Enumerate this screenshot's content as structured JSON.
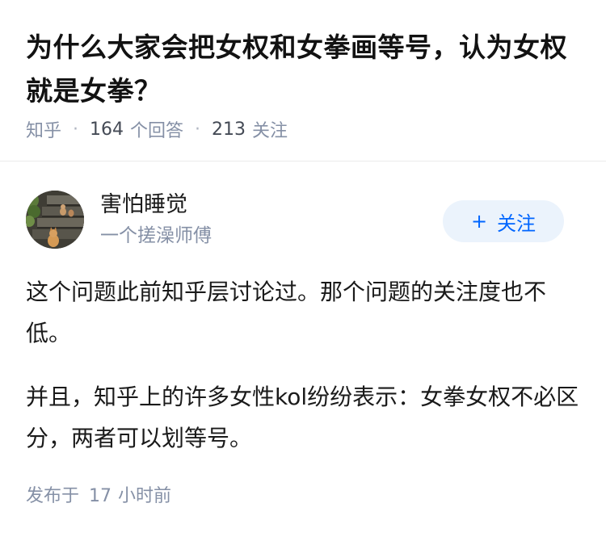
{
  "question": {
    "title": "为什么大家会把女权和女拳画等号，认为女权就是女拳？"
  },
  "meta": {
    "source": "知乎",
    "answer_count": "164",
    "answer_label": "个回答",
    "follower_count": "213",
    "follower_label": "关注"
  },
  "author": {
    "name": "害怕睡觉",
    "headline": "一个搓澡师傅",
    "avatar_icon": "cat-photo-avatar"
  },
  "follow_button": {
    "icon": "+",
    "label": "关注"
  },
  "answer": {
    "paragraphs": [
      "这个问题此前知乎层讨论过。那个问题的关注度也不低。",
      "并且，知乎上的许多女性kol纷纷表示：女拳女权不必区分，两者可以划等号。"
    ]
  },
  "publish": {
    "prefix": "发布于",
    "amount": "17",
    "unit": "小时前"
  },
  "colors": {
    "accent": "#0066ff",
    "button_bg": "#ebf3fc",
    "muted": "#8590a6"
  }
}
